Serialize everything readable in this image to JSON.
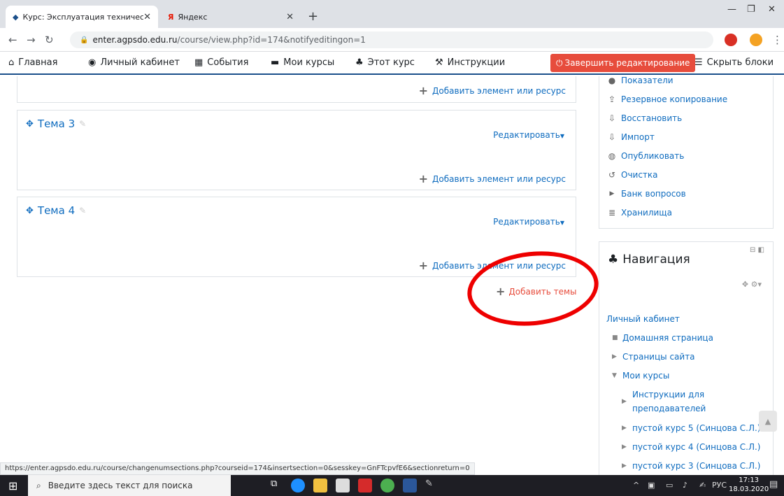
{
  "browser": {
    "tabs": [
      {
        "title": "Курс: Эксплуатация техническо"
      },
      {
        "title": "Яндекс"
      }
    ],
    "url_host": "enter.agpsdo.edu.ru",
    "url_path": "/course/view.php?id=174&notifyeditingon=1"
  },
  "navbar": {
    "home": "Главная",
    "dashboard": "Личный кабинет",
    "events": "События",
    "my_courses": "Мои курсы",
    "this_course": "Этот курс",
    "instructions": "Инструкции",
    "edit_toggle": "Завершить редактирование",
    "hide_blocks": "Скрыть блоки"
  },
  "sections": [
    {
      "title": "",
      "edit_label": "",
      "add_label": "Добавить элемент или ресурс"
    },
    {
      "title": "Тема 3",
      "edit_label": "Редактировать",
      "add_label": "Добавить элемент или ресурс"
    },
    {
      "title": "Тема 4",
      "edit_label": "Редактировать",
      "add_label": "Добавить элемент или ресурс"
    }
  ],
  "add_topics": "Добавить темы",
  "admin_links": [
    "Показатели",
    "Резервное копирование",
    "Восстановить",
    "Импорт",
    "Опубликовать",
    "Очистка",
    "Банк вопросов",
    "Хранилища"
  ],
  "navigation": {
    "title": "Навигация",
    "items": [
      "Личный кабинет",
      "Домашняя страница",
      "Страницы сайта",
      "Мои курсы",
      "Инструкции для",
      "преподавателей",
      "пустой курс 5 (Синцова С.Л.)",
      "пустой курс 4 (Синцова С.Л.)",
      "пустой курс 3 (Синцова С.Л.)"
    ]
  },
  "status_bar_url": "https://enter.agpsdo.edu.ru/course/changenumsections.php?courseid=174&insertsection=0&sesskey=GnFTcpvfE6&sectionreturn=0",
  "taskbar": {
    "search_placeholder": "Введите здесь текст для поиска",
    "lang": "РУС",
    "time": "17:13",
    "date": "18.03.2020"
  },
  "colors": {
    "accent": "#0f6cbf",
    "edit_button": "#e74c3c",
    "annotation": "#e00000"
  }
}
